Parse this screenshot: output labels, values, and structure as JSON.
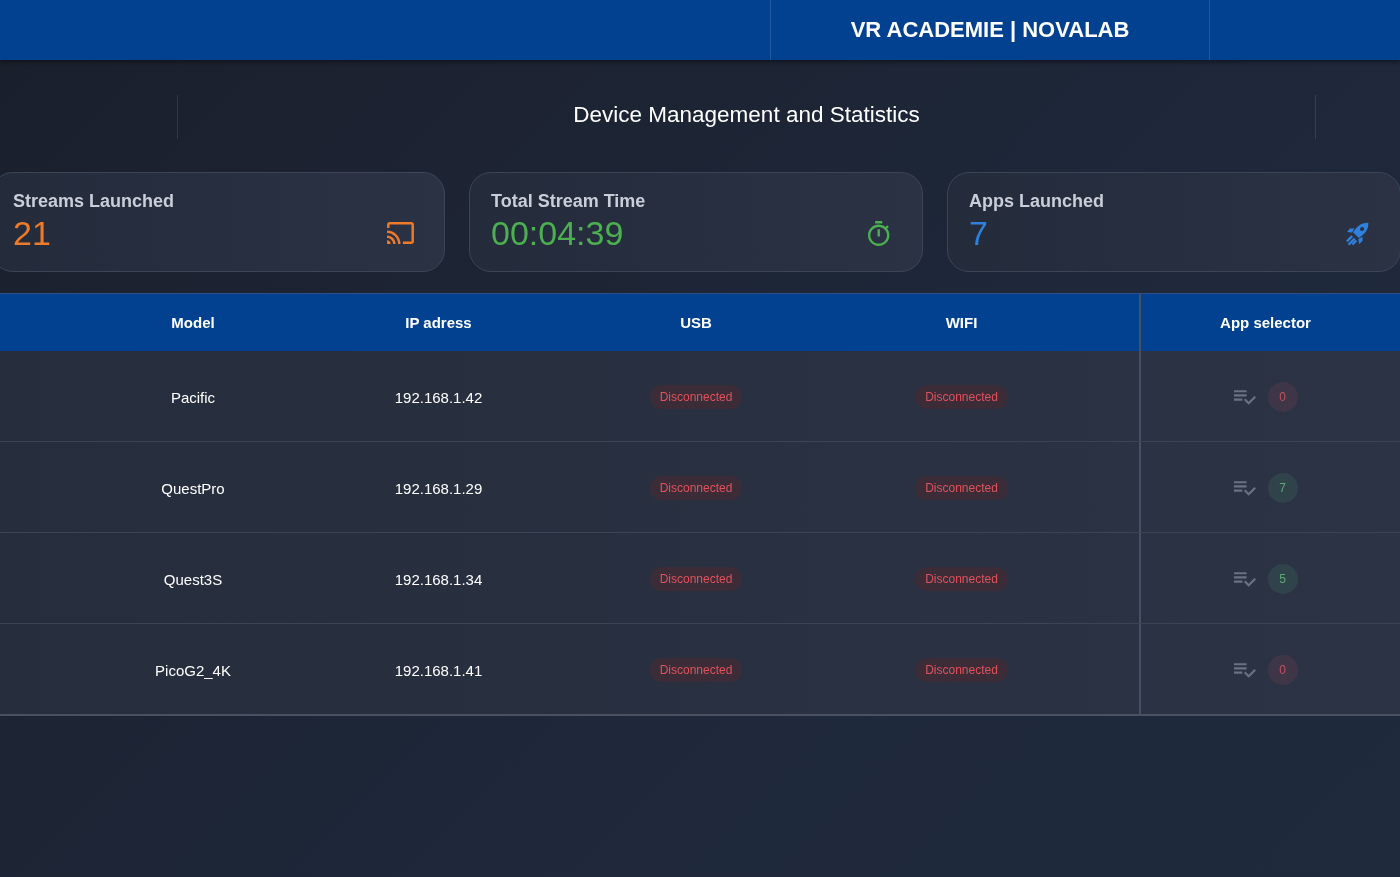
{
  "header": {
    "title": "VR ACADEMIE | NOVALAB"
  },
  "page_title": "Device Management and Statistics",
  "stats": [
    {
      "label": "Streams Launched",
      "value": "21",
      "color": "#ee7a2a",
      "kind": "cast"
    },
    {
      "label": "Total Stream Time",
      "value": "00:04:39",
      "color": "#4caf50",
      "kind": "timer"
    },
    {
      "label": "Apps Launched",
      "value": "7",
      "color": "#2f80dc",
      "kind": "rocket"
    }
  ],
  "table": {
    "columns": [
      "Model",
      "IP adress",
      "USB",
      "WIFI",
      "App selector"
    ],
    "rows": [
      {
        "model": "Pacific",
        "ip": "192.168.1.42",
        "usb": {
          "label": "Disconnected",
          "connected": false
        },
        "wifi": {
          "label": "Disconnected",
          "connected": false
        },
        "app_selector": {
          "count": "0",
          "color": "#c0525e",
          "disabled": true
        }
      },
      {
        "model": "QuestPro",
        "ip": "192.168.1.29",
        "usb": {
          "label": "Disconnected",
          "connected": false
        },
        "wifi": {
          "label": "Disconnected",
          "connected": false
        },
        "app_selector": {
          "count": "7",
          "color": "#5aaa78",
          "disabled": true
        }
      },
      {
        "model": "Quest3S",
        "ip": "192.168.1.34",
        "usb": {
          "label": "Disconnected",
          "connected": false
        },
        "wifi": {
          "label": "Disconnected",
          "connected": false
        },
        "app_selector": {
          "count": "5",
          "color": "#5aaa78",
          "disabled": true
        }
      },
      {
        "model": "PicoG2_4K",
        "ip": "192.168.1.41",
        "usb": {
          "label": "Disconnected",
          "connected": false
        },
        "wifi": {
          "label": "Disconnected",
          "connected": false
        },
        "app_selector": {
          "count": "0",
          "color": "#c0525e",
          "disabled": true
        }
      }
    ]
  }
}
